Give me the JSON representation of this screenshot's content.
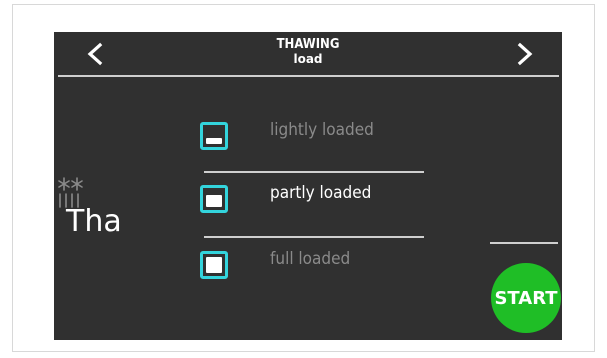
{
  "header": {
    "title": "THAWING",
    "subtitle": "load",
    "prev_icon": "chevron-left-icon",
    "next_icon": "chevron-right-icon"
  },
  "mode": {
    "icon": "snowflake-icon",
    "label": "Tha"
  },
  "options": [
    {
      "label": "lightly loaded",
      "selected": false,
      "fill_level": 1
    },
    {
      "label": "partly loaded",
      "selected": true,
      "fill_level": 2
    },
    {
      "label": "full loaded",
      "selected": false,
      "fill_level": 3
    }
  ],
  "start_button": {
    "label": "START"
  },
  "colors": {
    "screen_bg": "#303030",
    "accent_cyan": "#33d4dc",
    "start_green": "#1fbe26",
    "inactive_text": "#8a8a8a"
  }
}
